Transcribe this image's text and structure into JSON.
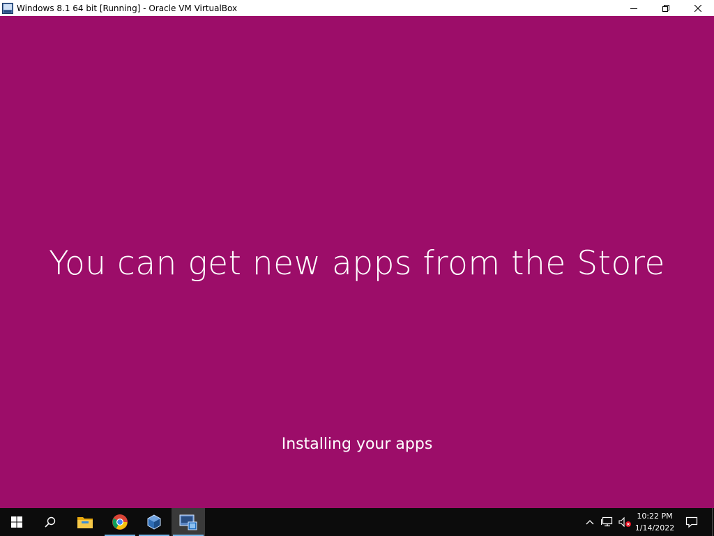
{
  "window": {
    "title": "Windows 8.1 64 bit [Running] - Oracle VM VirtualBox",
    "app_icon": "virtualbox-vm-icon",
    "controls": [
      "minimize-icon",
      "restore-icon",
      "close-icon"
    ]
  },
  "setup_screen": {
    "background_color": "#9c0d69",
    "headline": "You can get new apps from the Store",
    "status": "Installing your apps"
  },
  "taskbar": {
    "background_color": "#0c0c0c",
    "accent_color": "#76b9ed",
    "items": [
      {
        "name": "start",
        "icon": "windows-logo-icon"
      },
      {
        "name": "search",
        "icon": "search-icon"
      },
      {
        "name": "file-explorer",
        "icon": "folder-icon"
      },
      {
        "name": "chrome",
        "icon": "chrome-icon",
        "running": true
      },
      {
        "name": "virtualbox-manager",
        "icon": "virtualbox-icon",
        "running": true
      },
      {
        "name": "windows-81-vm",
        "icon": "vm-window-icon",
        "running": true,
        "active": true
      }
    ],
    "tray": {
      "icons": [
        "chevron-up-icon",
        "network-icon",
        "volume-muted-icon"
      ],
      "time": "10:22 PM",
      "date": "1/14/2022",
      "notifications_icon": "action-center-icon"
    }
  }
}
